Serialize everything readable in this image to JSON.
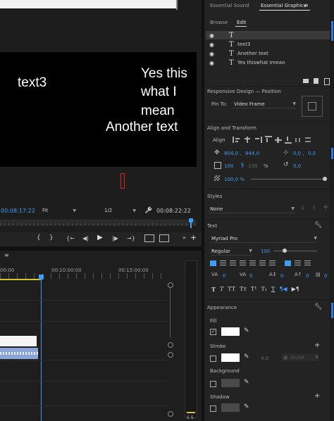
{
  "monitor": {
    "timecode_left": "00:08:17:22",
    "fit_label": "Fit",
    "resolution": "1/2",
    "timecode_right": "00:08:22:22",
    "canvas_texts": {
      "text3": "text3",
      "yes_line1": "Yes this",
      "yes_line2": "what I",
      "yes_line3": "mean",
      "another": "Another text"
    }
  },
  "timeline": {
    "ruler_labels": [
      "00:00",
      "00:10:00:00",
      "00:15:00:00"
    ]
  },
  "panel_tabs": {
    "essential_sound": "Essential Sound",
    "essential_graphics": "Essential Graphics"
  },
  "eg": {
    "subtabs": {
      "browse": "Browse",
      "edit": "Edit"
    },
    "layers": [
      {
        "label": ""
      },
      {
        "label": "text3"
      },
      {
        "label": "Another text"
      },
      {
        "label": "Yes thiswhat Imean"
      }
    ],
    "responsive_design": {
      "title": "Responsive Design — Position",
      "pin_to_label": "Pin To:",
      "pin_to_value": "Video Frame"
    },
    "align_transform": {
      "title": "Align and Transform",
      "align_label": "Align",
      "pos_x": "804,0 ,",
      "pos_y": "844,0",
      "anchor_x": "0,0 ,",
      "anchor_y": "0,0",
      "scale": "100",
      "scale_h": "100",
      "scale_unit": "%",
      "rotation": "0,0",
      "opacity": "100,0 %",
      "opacity_fraction": 0.95
    },
    "styles": {
      "title": "Styles",
      "value": "None"
    },
    "text": {
      "title": "Text",
      "font": "Myriad Pro",
      "weight": "Regular",
      "size": "100",
      "tracking": "0",
      "kerning": "0",
      "leading": "0",
      "baseline": "0",
      "tsume": "0"
    },
    "appearance": {
      "title": "Appearance",
      "fill_label": "Fill",
      "stroke_label": "Stroke",
      "stroke_width": "4,0",
      "stroke_type": "Outer",
      "background_label": "Background",
      "shadow_label": "Shadow"
    }
  }
}
